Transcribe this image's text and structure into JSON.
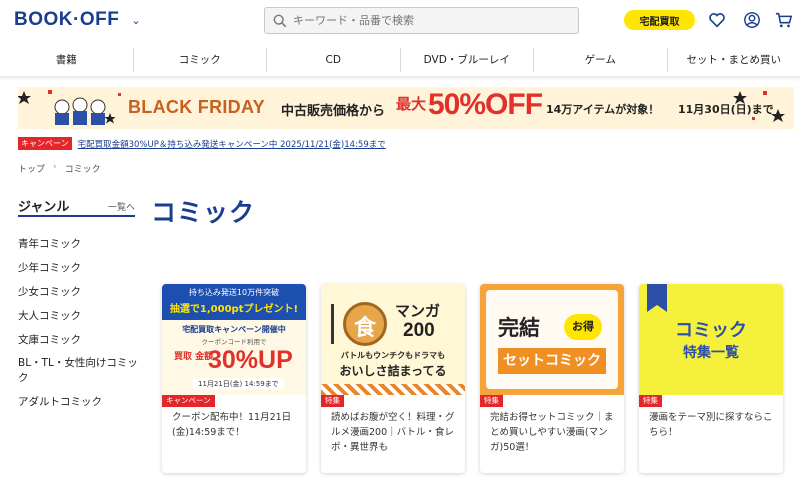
{
  "header": {
    "logo": "BOOK·OFF",
    "search_placeholder": "キーワード・品番で検索",
    "kaitori_label": "宅配買取",
    "icons": [
      "search-icon",
      "heart-icon",
      "user-icon",
      "cart-icon"
    ]
  },
  "nav": {
    "items": [
      "書籍",
      "コミック",
      "CD",
      "DVD・ブルーレイ",
      "ゲーム",
      "セット・まとめ買い"
    ]
  },
  "banner": {
    "title": "BLACK FRIDAY",
    "text1": "中古販売価格から",
    "text2": "最大",
    "percent": "50%OFF",
    "items": "14万アイテムが対象！",
    "date": "11月30日(日)まで"
  },
  "campaign": {
    "tag": "キャンペーン",
    "link": "宅配買取金額30%UP＆持ち込み発送キャンペーン中 2025/11/21(金)14:59まで"
  },
  "breadcrumb": [
    "トップ",
    "コミック"
  ],
  "sidebar": {
    "title": "ジャンル",
    "all_link": "一覧へ",
    "items": [
      "青年コミック",
      "少年コミック",
      "少女コミック",
      "大人コミック",
      "文庫コミック",
      "BL・TL・女性向けコミック",
      "アダルトコミック"
    ]
  },
  "page_title": "コミック",
  "cards": [
    {
      "tag": "キャンペーン",
      "text": "クーポン配布中！11月21日(金)14:59まで！",
      "img": {
        "line1": "持ち込み発送10万件突破",
        "line2": "抽選で1,000ptプレゼント!",
        "line3": "宅配買取キャンペーン開催中",
        "line4": "クーポンコード利用で",
        "line5": "買取 金額",
        "line6": "30%UP",
        "line7": "11月21日(金) 14:59まで"
      }
    },
    {
      "tag": "特集",
      "text": "読めばお腹が空く！料理・グルメ漫画200｜バトル・食レポ・異世界も",
      "img": {
        "mark": "食",
        "line1": "マンガ",
        "line2": "200",
        "line3": "バトルもウンチクもドラマも",
        "line4": "おいしさ詰まってる"
      }
    },
    {
      "tag": "特集",
      "text": "完結お得セットコミック｜まとめ買いしやすい漫画(マンガ)50選！",
      "img": {
        "line1": "完結",
        "badge": "お得",
        "line2": "セットコミック"
      }
    },
    {
      "tag": "特集",
      "text": "漫画をテーマ別に探すならこちら！",
      "img": {
        "line1": "コミック",
        "line2": "特集一覧"
      }
    }
  ]
}
